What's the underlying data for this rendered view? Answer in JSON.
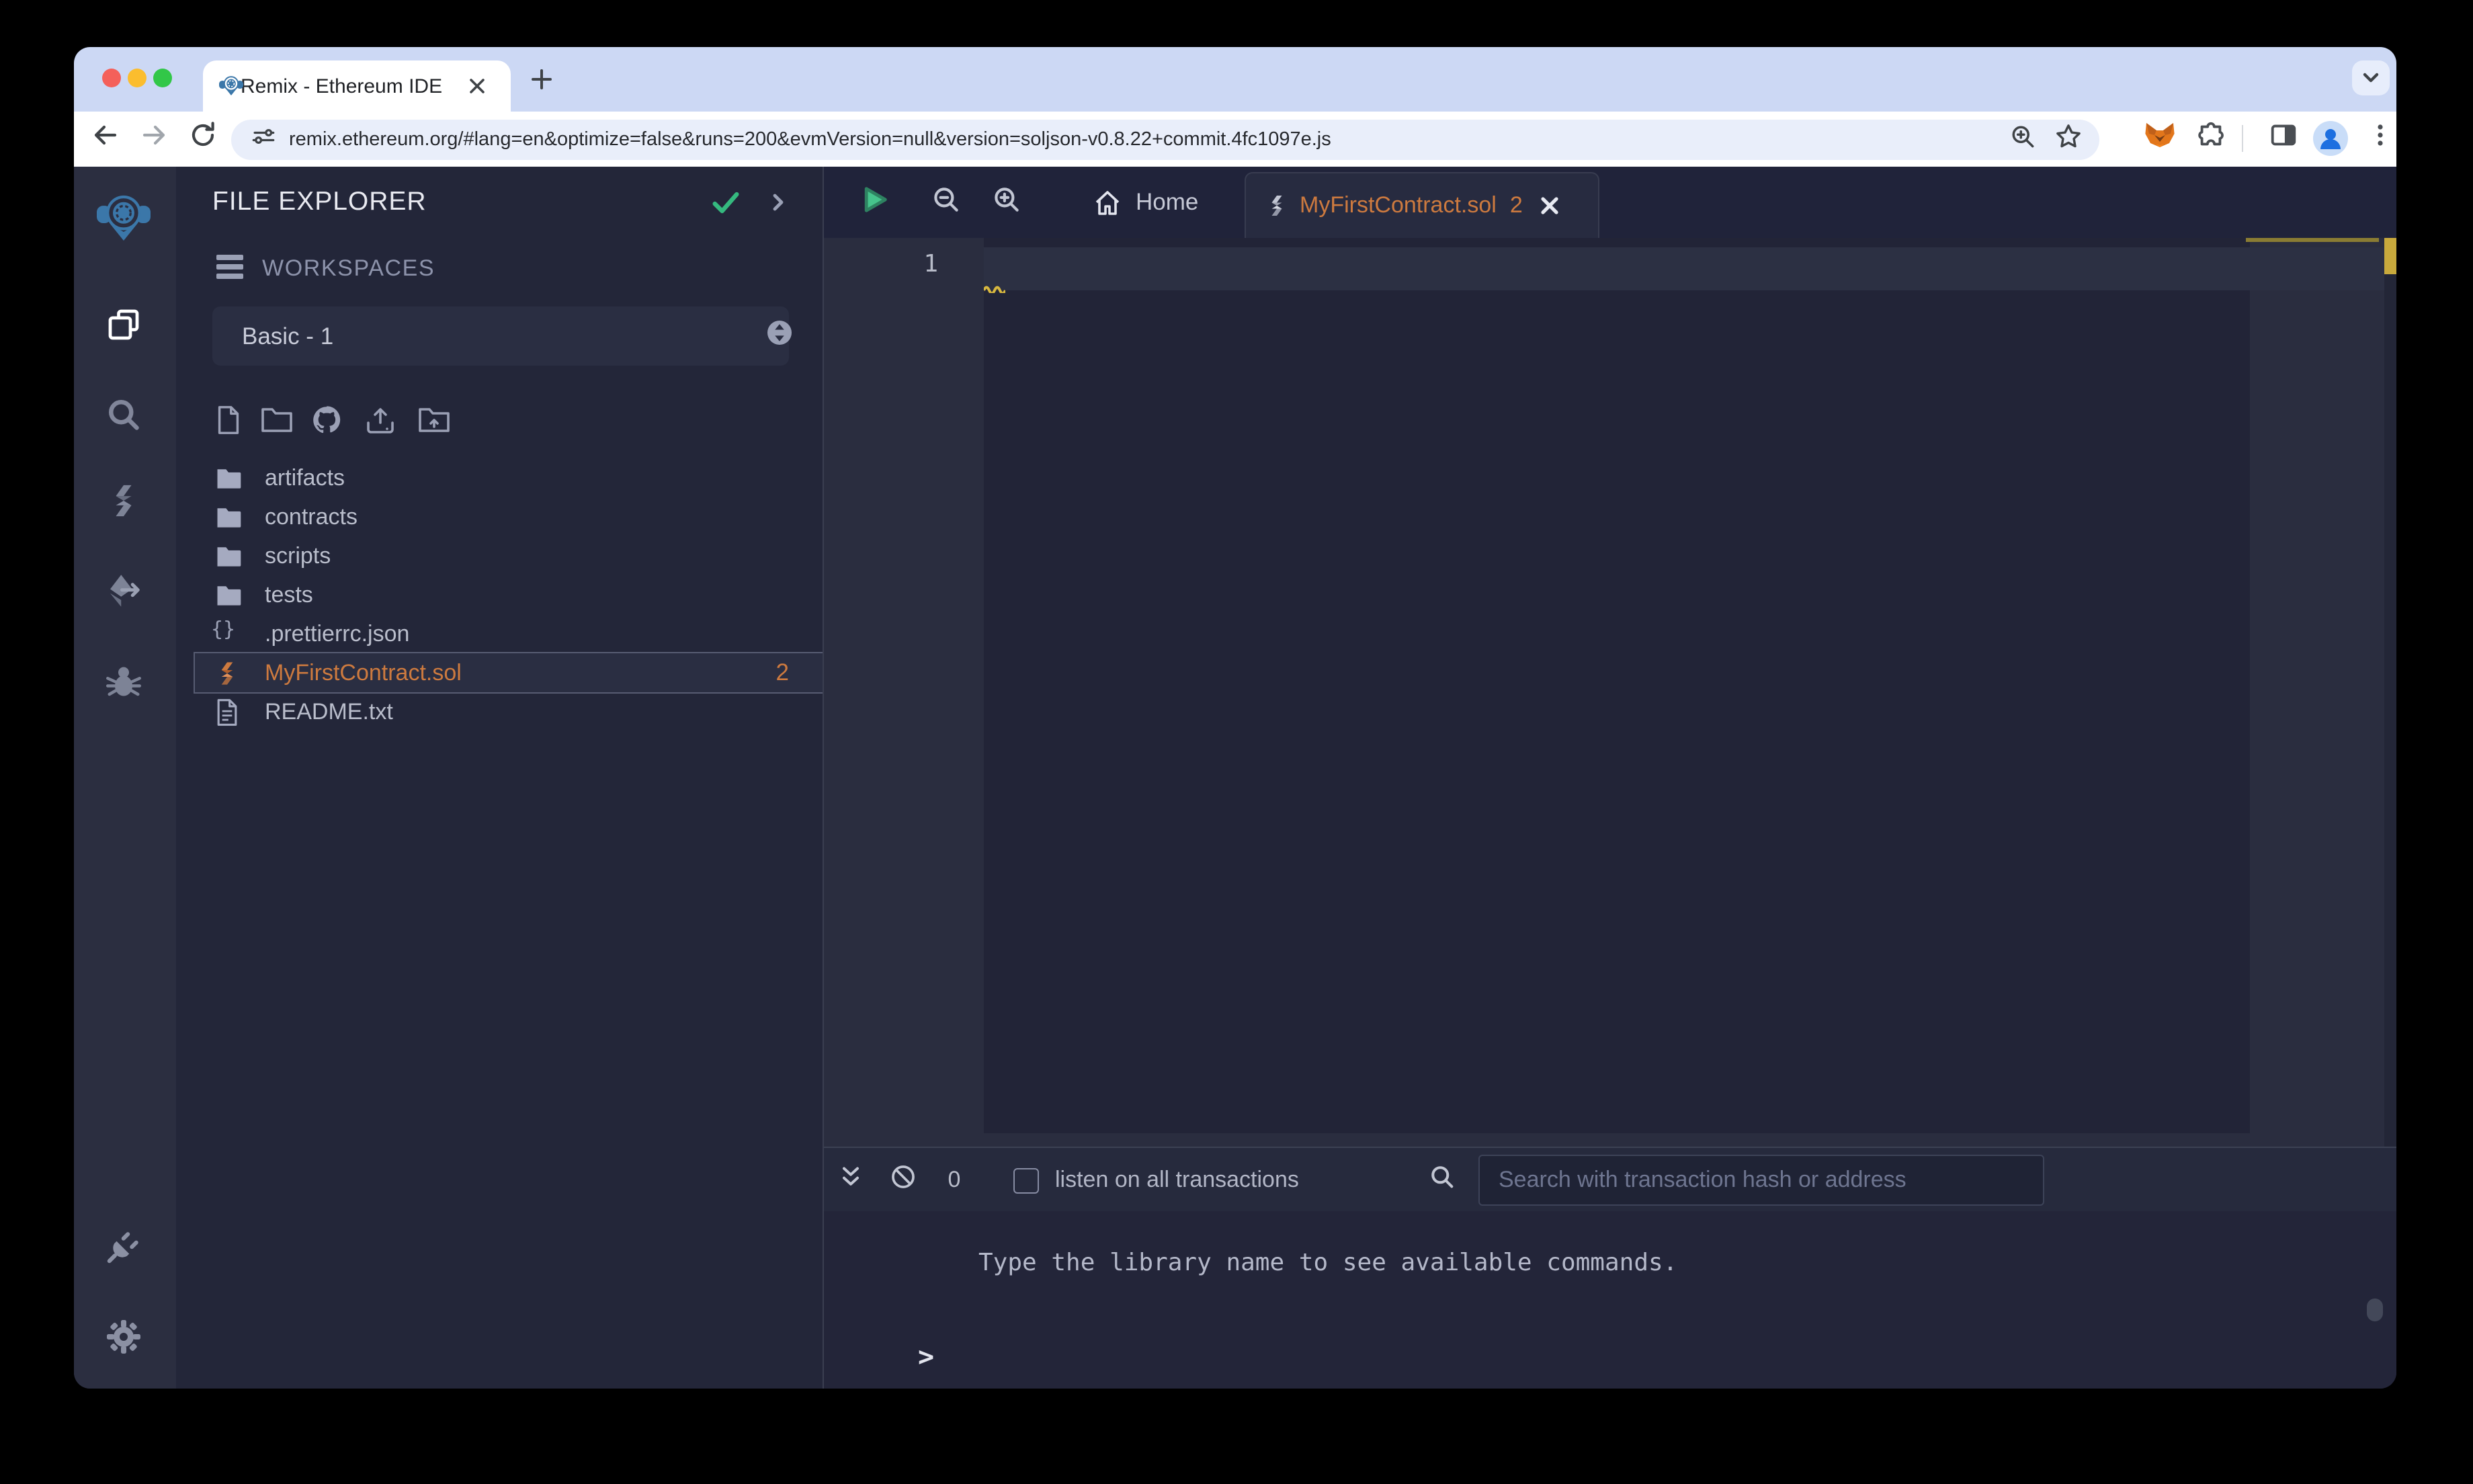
{
  "browser": {
    "tab_title": "Remix - Ethereum IDE",
    "url": "remix.ethereum.org/#lang=en&optimize=false&runs=200&evmVersion=null&version=soljson-v0.8.22+commit.4fc1097e.js"
  },
  "file_explorer": {
    "title": "FILE EXPLORER",
    "workspaces_label": "WORKSPACES",
    "workspace_name": "Basic - 1",
    "files": [
      {
        "name": "artifacts",
        "type": "folder"
      },
      {
        "name": "contracts",
        "type": "folder"
      },
      {
        "name": "scripts",
        "type": "folder"
      },
      {
        "name": "tests",
        "type": "folder"
      },
      {
        "name": ".prettierrc.json",
        "type": "json",
        "icon_glyph": "{}"
      },
      {
        "name": "MyFirstContract.sol",
        "type": "solidity",
        "selected": true,
        "badge": "2"
      },
      {
        "name": "README.txt",
        "type": "text"
      }
    ]
  },
  "editor": {
    "home_tab_label": "Home",
    "active_tab": {
      "name": "MyFirstContract.sol",
      "badge": "2"
    },
    "line_number": "1"
  },
  "terminal": {
    "count": "0",
    "listen_label": "listen on all transactions",
    "search_placeholder": "Search with transaction hash or address",
    "message": "Type the library name to see available commands.",
    "prompt": ">"
  },
  "colors": {
    "accent_orange": "#cd7a3f",
    "warning_yellow": "#c8a93c",
    "success_green": "#35b97f",
    "remix_blue": "#3b77a9",
    "tabstrip": "#ccd8f4"
  }
}
